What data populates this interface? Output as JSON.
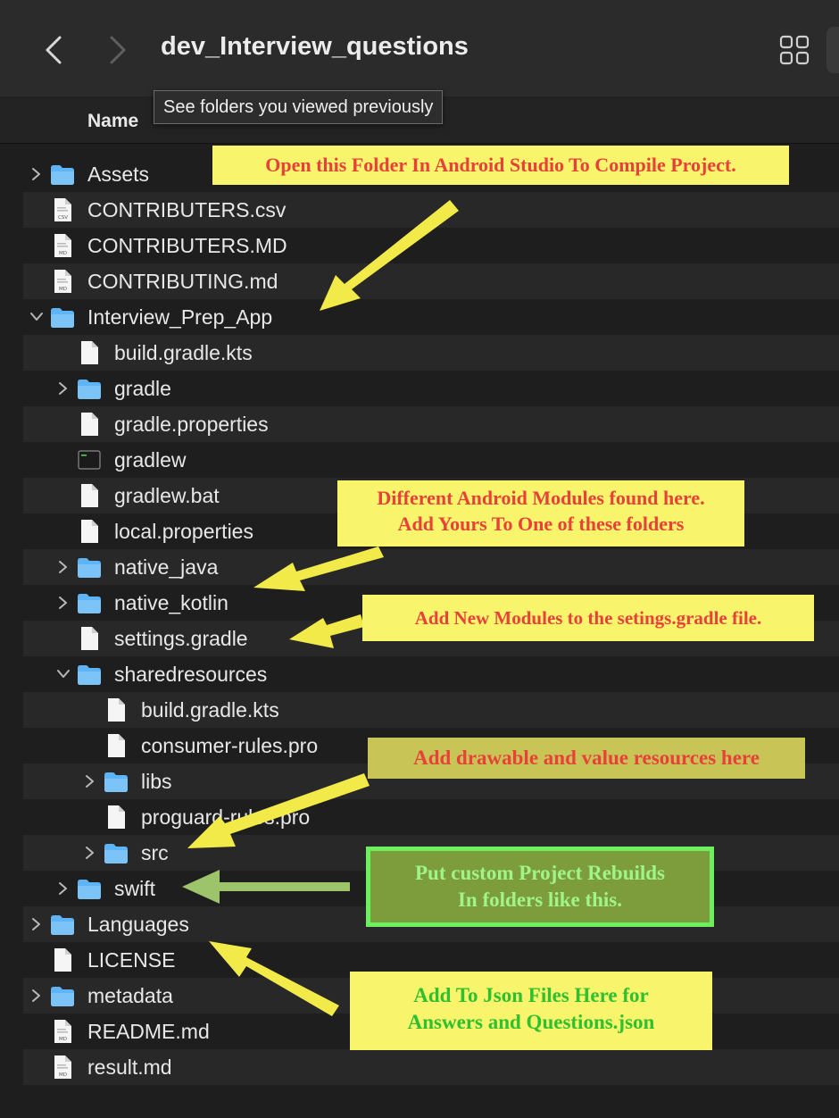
{
  "window": {
    "title": "dev_Interview_questions",
    "tooltip": "See folders you viewed previously"
  },
  "columns": {
    "name": "Name"
  },
  "rows": [
    {
      "label": "Assets",
      "kind": "folder",
      "depth": 0,
      "disclosure": "collapsed",
      "icon": "folder-icon"
    },
    {
      "label": "CONTRIBUTERS.csv",
      "kind": "file",
      "depth": 0,
      "badge": "CSV",
      "icon": "csv-file-icon"
    },
    {
      "label": "CONTRIBUTERS.MD",
      "kind": "file",
      "depth": 0,
      "badge": "MD",
      "icon": "md-file-icon"
    },
    {
      "label": "CONTRIBUTING.md",
      "kind": "file",
      "depth": 0,
      "badge": "MD",
      "icon": "md-file-icon"
    },
    {
      "label": "Interview_Prep_App",
      "kind": "folder",
      "depth": 0,
      "disclosure": "expanded",
      "icon": "folder-icon"
    },
    {
      "label": "build.gradle.kts",
      "kind": "file",
      "depth": 1,
      "icon": "file-icon"
    },
    {
      "label": "gradle",
      "kind": "folder",
      "depth": 1,
      "disclosure": "collapsed",
      "icon": "folder-icon"
    },
    {
      "label": "gradle.properties",
      "kind": "file",
      "depth": 1,
      "icon": "file-icon"
    },
    {
      "label": "gradlew",
      "kind": "exec",
      "depth": 1,
      "badge": "exec",
      "icon": "terminal-icon"
    },
    {
      "label": "gradlew.bat",
      "kind": "file",
      "depth": 1,
      "icon": "file-icon"
    },
    {
      "label": "local.properties",
      "kind": "file",
      "depth": 1,
      "icon": "file-icon"
    },
    {
      "label": "native_java",
      "kind": "folder",
      "depth": 1,
      "disclosure": "collapsed",
      "icon": "folder-icon"
    },
    {
      "label": "native_kotlin",
      "kind": "folder",
      "depth": 1,
      "disclosure": "collapsed",
      "icon": "folder-icon"
    },
    {
      "label": "settings.gradle",
      "kind": "file",
      "depth": 1,
      "icon": "file-icon"
    },
    {
      "label": "sharedresources",
      "kind": "folder",
      "depth": 1,
      "disclosure": "expanded",
      "icon": "folder-icon"
    },
    {
      "label": "build.gradle.kts",
      "kind": "file",
      "depth": 2,
      "icon": "file-icon"
    },
    {
      "label": "consumer-rules.pro",
      "kind": "file",
      "depth": 2,
      "icon": "file-icon"
    },
    {
      "label": "libs",
      "kind": "folder",
      "depth": 2,
      "disclosure": "collapsed",
      "icon": "folder-icon"
    },
    {
      "label": "proguard-rules.pro",
      "kind": "file",
      "depth": 2,
      "icon": "file-icon"
    },
    {
      "label": "src",
      "kind": "folder",
      "depth": 2,
      "disclosure": "collapsed",
      "icon": "folder-icon"
    },
    {
      "label": "swift",
      "kind": "folder",
      "depth": 1,
      "disclosure": "collapsed",
      "icon": "folder-icon"
    },
    {
      "label": "Languages",
      "kind": "folder",
      "depth": 0,
      "disclosure": "collapsed",
      "icon": "folder-icon"
    },
    {
      "label": "LICENSE",
      "kind": "file",
      "depth": 0,
      "icon": "file-icon"
    },
    {
      "label": "metadata",
      "kind": "folder",
      "depth": 0,
      "disclosure": "collapsed",
      "icon": "folder-icon"
    },
    {
      "label": "README.md",
      "kind": "file",
      "depth": 0,
      "badge": "MD",
      "icon": "md-file-icon"
    },
    {
      "label": "result.md",
      "kind": "file",
      "depth": 0,
      "badge": "MD",
      "icon": "md-file-icon"
    }
  ],
  "annotations": {
    "open_folder": "Open this Folder In Android Studio To Compile Project.",
    "modules_line1": "Different Android Modules found here.",
    "modules_line2": "Add Yours To One of these folders",
    "settings": "Add New Modules to the setings.gradle file.",
    "resources": "Add drawable and value resources here",
    "rebuilds_line1": "Put custom Project Rebuilds",
    "rebuilds_line2": "In folders like this.",
    "json_line1": "Add To Json Files Here for",
    "json_line2": "Answers and Questions.json"
  },
  "colors": {
    "folder": "#5fb4f5",
    "note_yellow": "#f8f46b",
    "note_red_text": "#e8413a",
    "note_green_text": "#2fbf2f",
    "rebuild_bg": "#7d9d3c",
    "rebuild_border": "#6df060",
    "arrow_yellow": "#f2ea49",
    "arrow_green": "#9dc46a"
  }
}
